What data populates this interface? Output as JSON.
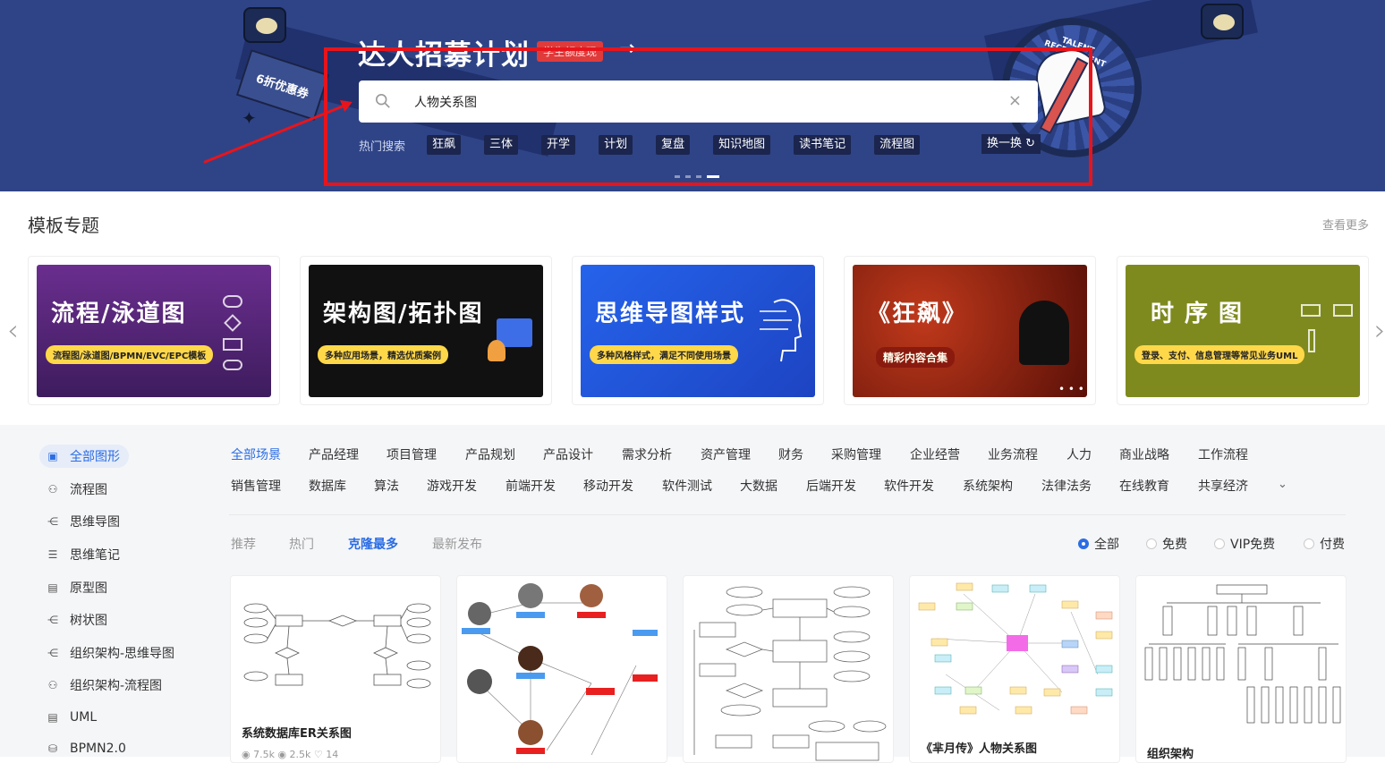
{
  "banner": {
    "title": "达人招募计划",
    "badge": "学生额度现",
    "arrow": "→",
    "coupon": "6折优惠券",
    "talent_text": "TALENT RECRUITMENT",
    "search": {
      "value": "人物关系图",
      "clear": "×"
    },
    "hot_label": "热门搜索",
    "hot_tags": [
      "狂飙",
      "三体",
      "开学",
      "计划",
      "复盘",
      "知识地图",
      "读书笔记",
      "流程图"
    ],
    "swap": "换一换 ↻"
  },
  "topics": {
    "title": "模板专题",
    "more": "查看更多",
    "prev": "‹",
    "next": "›",
    "cards": [
      {
        "title": "流程/泳道图",
        "subtitle": "流程图/泳道图/BPMN/EVC/EPC模板"
      },
      {
        "title": "架构图/拓扑图",
        "subtitle": "多种应用场景，精选优质案例"
      },
      {
        "title": "思维导图样式",
        "subtitle": "多种风格样式，满足不同使用场景"
      },
      {
        "title": "《狂飙》",
        "subtitle": "精彩内容合集"
      },
      {
        "title": "时序图",
        "subtitle": "登录、支付、信息管理等常见业务UML"
      }
    ]
  },
  "sidebar": {
    "items": [
      {
        "label": "全部图形",
        "icon": "all-shapes-icon"
      },
      {
        "label": "流程图",
        "icon": "flowchart-icon"
      },
      {
        "label": "思维导图",
        "icon": "mindmap-icon"
      },
      {
        "label": "思维笔记",
        "icon": "notes-icon"
      },
      {
        "label": "原型图",
        "icon": "prototype-icon"
      },
      {
        "label": "树状图",
        "icon": "tree-icon"
      },
      {
        "label": "组织架构-思维导图",
        "icon": "org-mindmap-icon"
      },
      {
        "label": "组织架构-流程图",
        "icon": "org-flowchart-icon"
      },
      {
        "label": "UML",
        "icon": "uml-icon"
      },
      {
        "label": "BPMN2.0",
        "icon": "bpmn-icon"
      }
    ]
  },
  "scenes": {
    "row1": [
      "全部场景",
      "产品经理",
      "项目管理",
      "产品规划",
      "产品设计",
      "需求分析",
      "资产管理",
      "财务",
      "采购管理",
      "企业经营",
      "业务流程",
      "人力",
      "商业战略",
      "工作流程"
    ],
    "row2": [
      "销售管理",
      "数据库",
      "算法",
      "游戏开发",
      "前端开发",
      "移动开发",
      "软件测试",
      "大数据",
      "后端开发",
      "软件开发",
      "系统架构",
      "法律法务",
      "在线教育",
      "共享经济"
    ],
    "expand": "⌄"
  },
  "sort_tabs": [
    "推荐",
    "热门",
    "克隆最多",
    "最新发布"
  ],
  "price_filter": [
    "全部",
    "免费",
    "VIP免费",
    "付费"
  ],
  "templates": [
    {
      "name": "系统数据库ER关系图",
      "stats": "◉ 7.5k  ◉ 2.5k  ♡ 14"
    },
    {
      "name": "",
      "stats": ""
    },
    {
      "name": "",
      "stats": ""
    },
    {
      "name": "《芈月传》人物关系图",
      "stats": ""
    },
    {
      "name": "组织架构",
      "stats": ""
    }
  ],
  "colors": {
    "accent": "#2b6de4",
    "banner_bg": "#2f4487",
    "annotation_red": "#e8141b"
  }
}
